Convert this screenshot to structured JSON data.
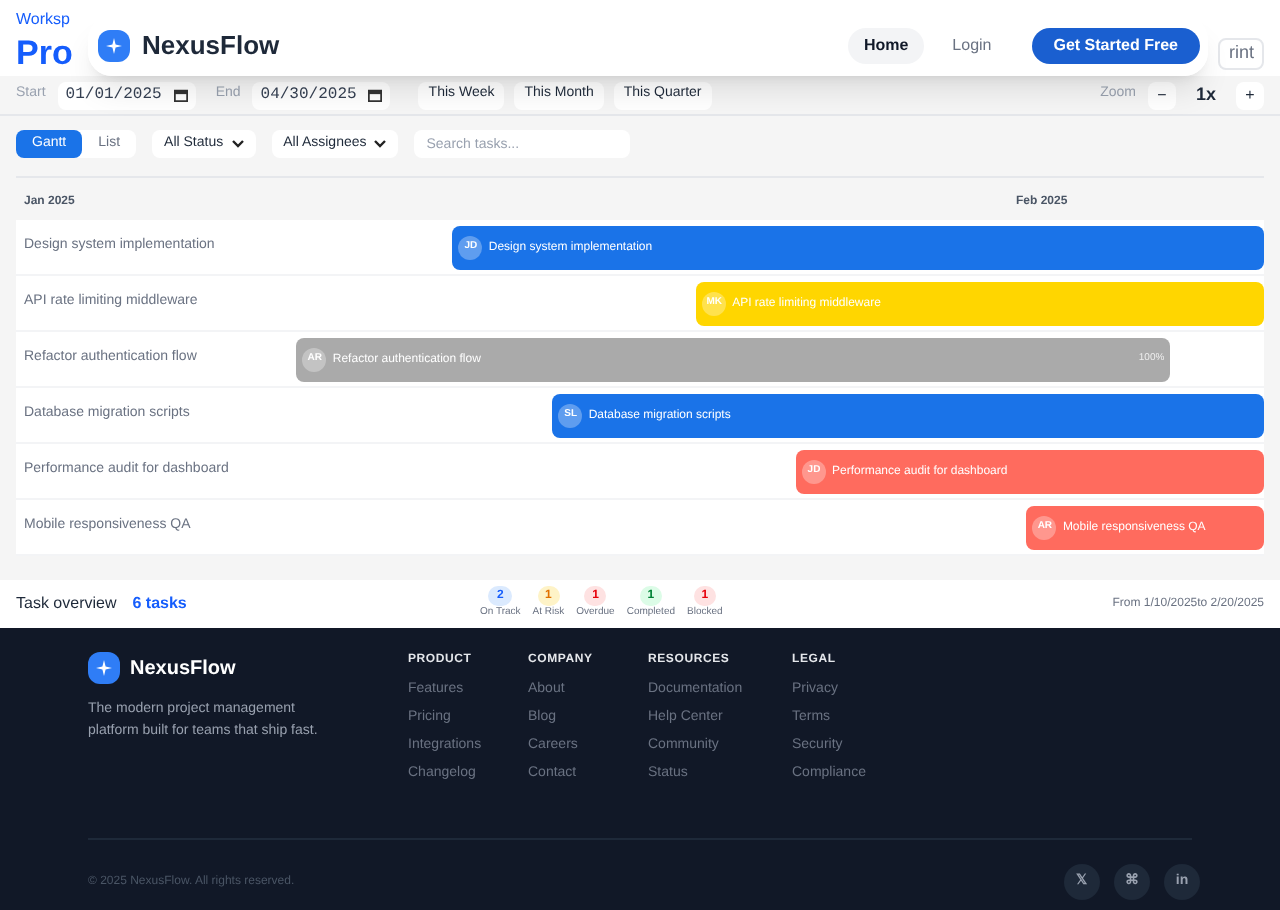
{
  "page_header": {
    "breadcrumb": "Worksp",
    "title": "Pro",
    "print_button": "rint"
  },
  "nav": {
    "brand": "NexusFlow",
    "links": [
      {
        "label": "Home",
        "selected": true
      },
      {
        "label": "Login",
        "selected": false
      }
    ],
    "cta": "Get Started Free"
  },
  "date_bar": {
    "start_label": "Start",
    "start_value": "01/01/2025",
    "end_label": "End",
    "end_value": "04/30/2025",
    "presets": [
      "This Week",
      "This Month",
      "This Quarter"
    ],
    "zoom_label": "Zoom",
    "zoom_out": "−",
    "zoom_value": "1x",
    "zoom_in": "+"
  },
  "toolbar": {
    "views": [
      {
        "label": "Gantt",
        "selected": true
      },
      {
        "label": "List",
        "selected": false
      }
    ],
    "status_filter": "All Status",
    "assignee_filter": "All Assignees",
    "search": {
      "placeholder": "Search tasks..."
    }
  },
  "gantt": {
    "months": [
      "Jan 2025",
      "Feb 2025"
    ],
    "tasks": [
      {
        "name": "Design system implementation",
        "bar_label": "Design system implementation",
        "initials": "JD",
        "color": "#1a73e8"
      },
      {
        "name": "API rate limiting middleware",
        "bar_label": "API rate limiting middleware",
        "initials": "MK",
        "color": "#ffd600"
      },
      {
        "name": "Refactor authentication flow",
        "bar_label": "Refactor authentication flow",
        "initials": "AR",
        "color": "#aaaaaa",
        "progress": "100%"
      },
      {
        "name": "Database migration scripts",
        "bar_label": "Database migration scripts",
        "initials": "SL",
        "color": "#1a73e8"
      },
      {
        "name": "Performance audit for dashboard",
        "bar_label": "Performance audit for dashboard",
        "initials": "JD",
        "color": "#ff6b5e"
      },
      {
        "name": "Mobile responsiveness QA",
        "bar_label": "Mobile responsiveness QA",
        "initials": "AR",
        "color": "#ff6b5e"
      }
    ]
  },
  "summary": {
    "title": "Task overview",
    "count": "6 tasks",
    "stats": [
      {
        "value": "2",
        "label": "On Track",
        "color": "#dbeafe"
      },
      {
        "value": "1",
        "label": "At Risk",
        "color": "#fef3c7"
      },
      {
        "value": "1",
        "label": "Overdue",
        "color": "#fee2e2"
      },
      {
        "value": "1",
        "label": "Completed",
        "color": "#dcfce7"
      },
      {
        "value": "1",
        "label": "Blocked",
        "color": "#fee2e2"
      }
    ],
    "range": "From 1/10/2025to 2/20/2025"
  },
  "footer": {
    "brand": "NexusFlow",
    "tagline": "The modern project management platform built for teams that ship fast.",
    "columns": [
      {
        "heading": "PRODUCT",
        "links": [
          "Features",
          "Pricing",
          "Integrations",
          "Changelog"
        ]
      },
      {
        "heading": "COMPANY",
        "links": [
          "About",
          "Blog",
          "Careers",
          "Contact"
        ]
      },
      {
        "heading": "RESOURCES",
        "links": [
          "Documentation",
          "Help Center",
          "Community",
          "Status"
        ]
      },
      {
        "heading": "LEGAL",
        "links": [
          "Privacy",
          "Terms",
          "Security",
          "Compliance"
        ]
      }
    ],
    "copyright": "© 2025 NexusFlow. All rights reserved.",
    "social": [
      "𝕏",
      "⌘",
      "in"
    ]
  }
}
